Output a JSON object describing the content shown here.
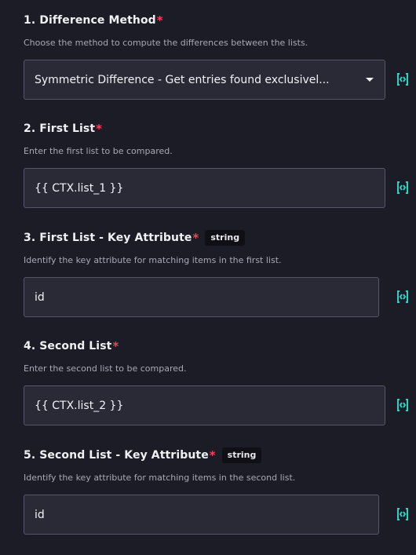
{
  "fields": [
    {
      "label": "1. Difference Method",
      "required": "*",
      "description": "Choose the method to compute the differences between the lists.",
      "value": "Symmetric Difference - Get entries found exclusivel...",
      "badge": ""
    },
    {
      "label": "2. First List",
      "required": "*",
      "description": "Enter the first list to be compared.",
      "value": "{{ CTX.list_1 }}",
      "badge": ""
    },
    {
      "label": "3. First List - Key Attribute",
      "required": "*",
      "description": "Identify the key attribute for matching items in the first list.",
      "value": "id",
      "badge": "string"
    },
    {
      "label": "4. Second List",
      "required": "*",
      "description": "Enter the second list to be compared.",
      "value": "{{ CTX.list_2 }}",
      "badge": ""
    },
    {
      "label": "5. Second List - Key Attribute",
      "required": "*",
      "description": "Identify the key attribute for matching items in the second list.",
      "value": "id",
      "badge": "string"
    }
  ],
  "icons": {
    "expression_toggle": "code-brackets-icon",
    "dropdown": "chevron-down-icon"
  },
  "colors": {
    "background": "#1c1c26",
    "input_background": "#2a2a37",
    "input_border": "#55556a",
    "required_asterisk": "#ff3d57",
    "accent_icon": "#2ad4c4"
  }
}
